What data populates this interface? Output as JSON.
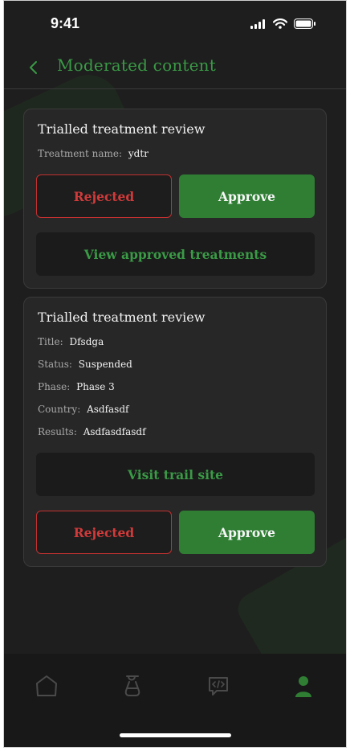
{
  "status_bar": {
    "time": "9:41"
  },
  "header": {
    "title": "Moderated content"
  },
  "cards": [
    {
      "title": "Trialled treatment review",
      "fields": [
        {
          "label": "Treatment name:",
          "value": "ydtr"
        }
      ],
      "reject_label": "Rejected",
      "approve_label": "Approve",
      "secondary_label": "View approved treatments"
    },
    {
      "title": "Trialled treatment review",
      "fields": [
        {
          "label": "Title:",
          "value": "Dfsdga"
        },
        {
          "label": "Status:",
          "value": "Suspended"
        },
        {
          "label": "Phase:",
          "value": "Phase 3"
        },
        {
          "label": "Country:",
          "value": "Asdfasdf"
        },
        {
          "label": "Results:",
          "value": "Asdfasdfasdf"
        }
      ],
      "secondary_label": "Visit trail site",
      "reject_label": "Rejected",
      "approve_label": "Approve"
    }
  ],
  "colors": {
    "accent": "#3a9a46",
    "approve": "#2f7e34",
    "reject": "#d23a3a",
    "background": "#1e1e1e"
  },
  "nav": {
    "items": [
      "home-icon",
      "flask-icon",
      "chat-code-icon",
      "profile-icon"
    ],
    "active": "profile-icon"
  }
}
